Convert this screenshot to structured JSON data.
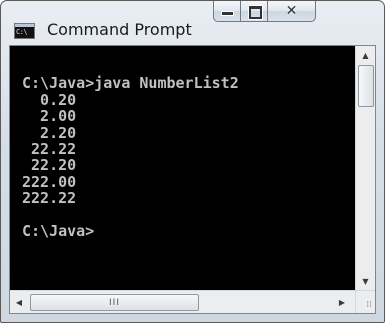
{
  "window": {
    "title": "Command Prompt",
    "icon_text": "C:\\",
    "icon": "console-icon"
  },
  "caption_buttons": {
    "minimize": "minimize-icon",
    "maximize": "maximize-icon",
    "close": "close-icon"
  },
  "console": {
    "lines": [
      "",
      "C:\\Java>java NumberList2",
      "  0.20",
      "  2.00",
      "  2.20",
      " 22.22",
      " 22.20",
      "222.00",
      "222.22",
      "",
      "C:\\Java>"
    ]
  },
  "scrollbars": {
    "up_arrow": "▲",
    "down_arrow": "▼",
    "left_arrow": "◀",
    "right_arrow": "▶",
    "thumb_grip": "III",
    "size_grip": "⁞⁞"
  },
  "colors": {
    "console_bg": "#000000",
    "console_text": "#c0c0c0"
  }
}
